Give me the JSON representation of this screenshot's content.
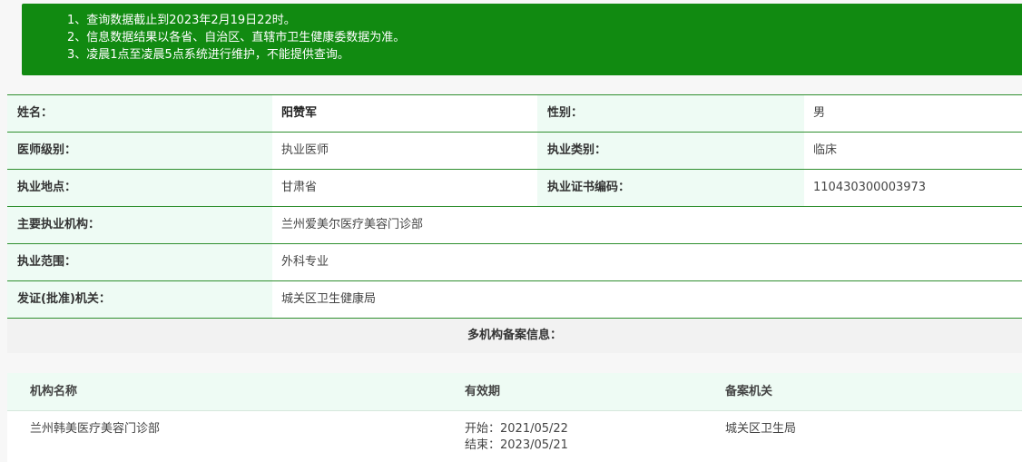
{
  "notice": {
    "lines": [
      "1、查询数据截止到2023年2月19日22时。",
      "2、信息数据结果以各省、自治区、直辖市卫生健康委数据为准。",
      "3、凌晨1点至凌晨5点系统进行维护，不能提供查询。"
    ]
  },
  "info": {
    "name_label": "姓名：",
    "name_value": "阳赞军",
    "gender_label": "性别：",
    "gender_value": "男",
    "level_label": "医师级别：",
    "level_value": "执业医师",
    "category_label": "执业类别：",
    "category_value": "临床",
    "location_label": "执业地点：",
    "location_value": "甘肃省",
    "cert_label": "执业证书编码：",
    "cert_value": "110430300003973",
    "org_label": "主要执业机构：",
    "org_value": "兰州爱美尔医疗美容门诊部",
    "scope_label": "执业范围：",
    "scope_value": "外科专业",
    "issuer_label": "发证(批准)机关：",
    "issuer_value": "城关区卫生健康局"
  },
  "multi": {
    "title": "多机构备案信息：",
    "headers": [
      "机构名称",
      "有效期",
      "备案机关"
    ],
    "rows": [
      {
        "org": "兰州韩美医疗美容门诊部",
        "start": "开始：2021/05/22",
        "end": "结束：2023/05/21",
        "authority": "城关区卫生局"
      }
    ]
  },
  "colors": {
    "notice_bg": "#118a11",
    "label_bg": "#eefbf4",
    "border": "#2f8f2f"
  }
}
